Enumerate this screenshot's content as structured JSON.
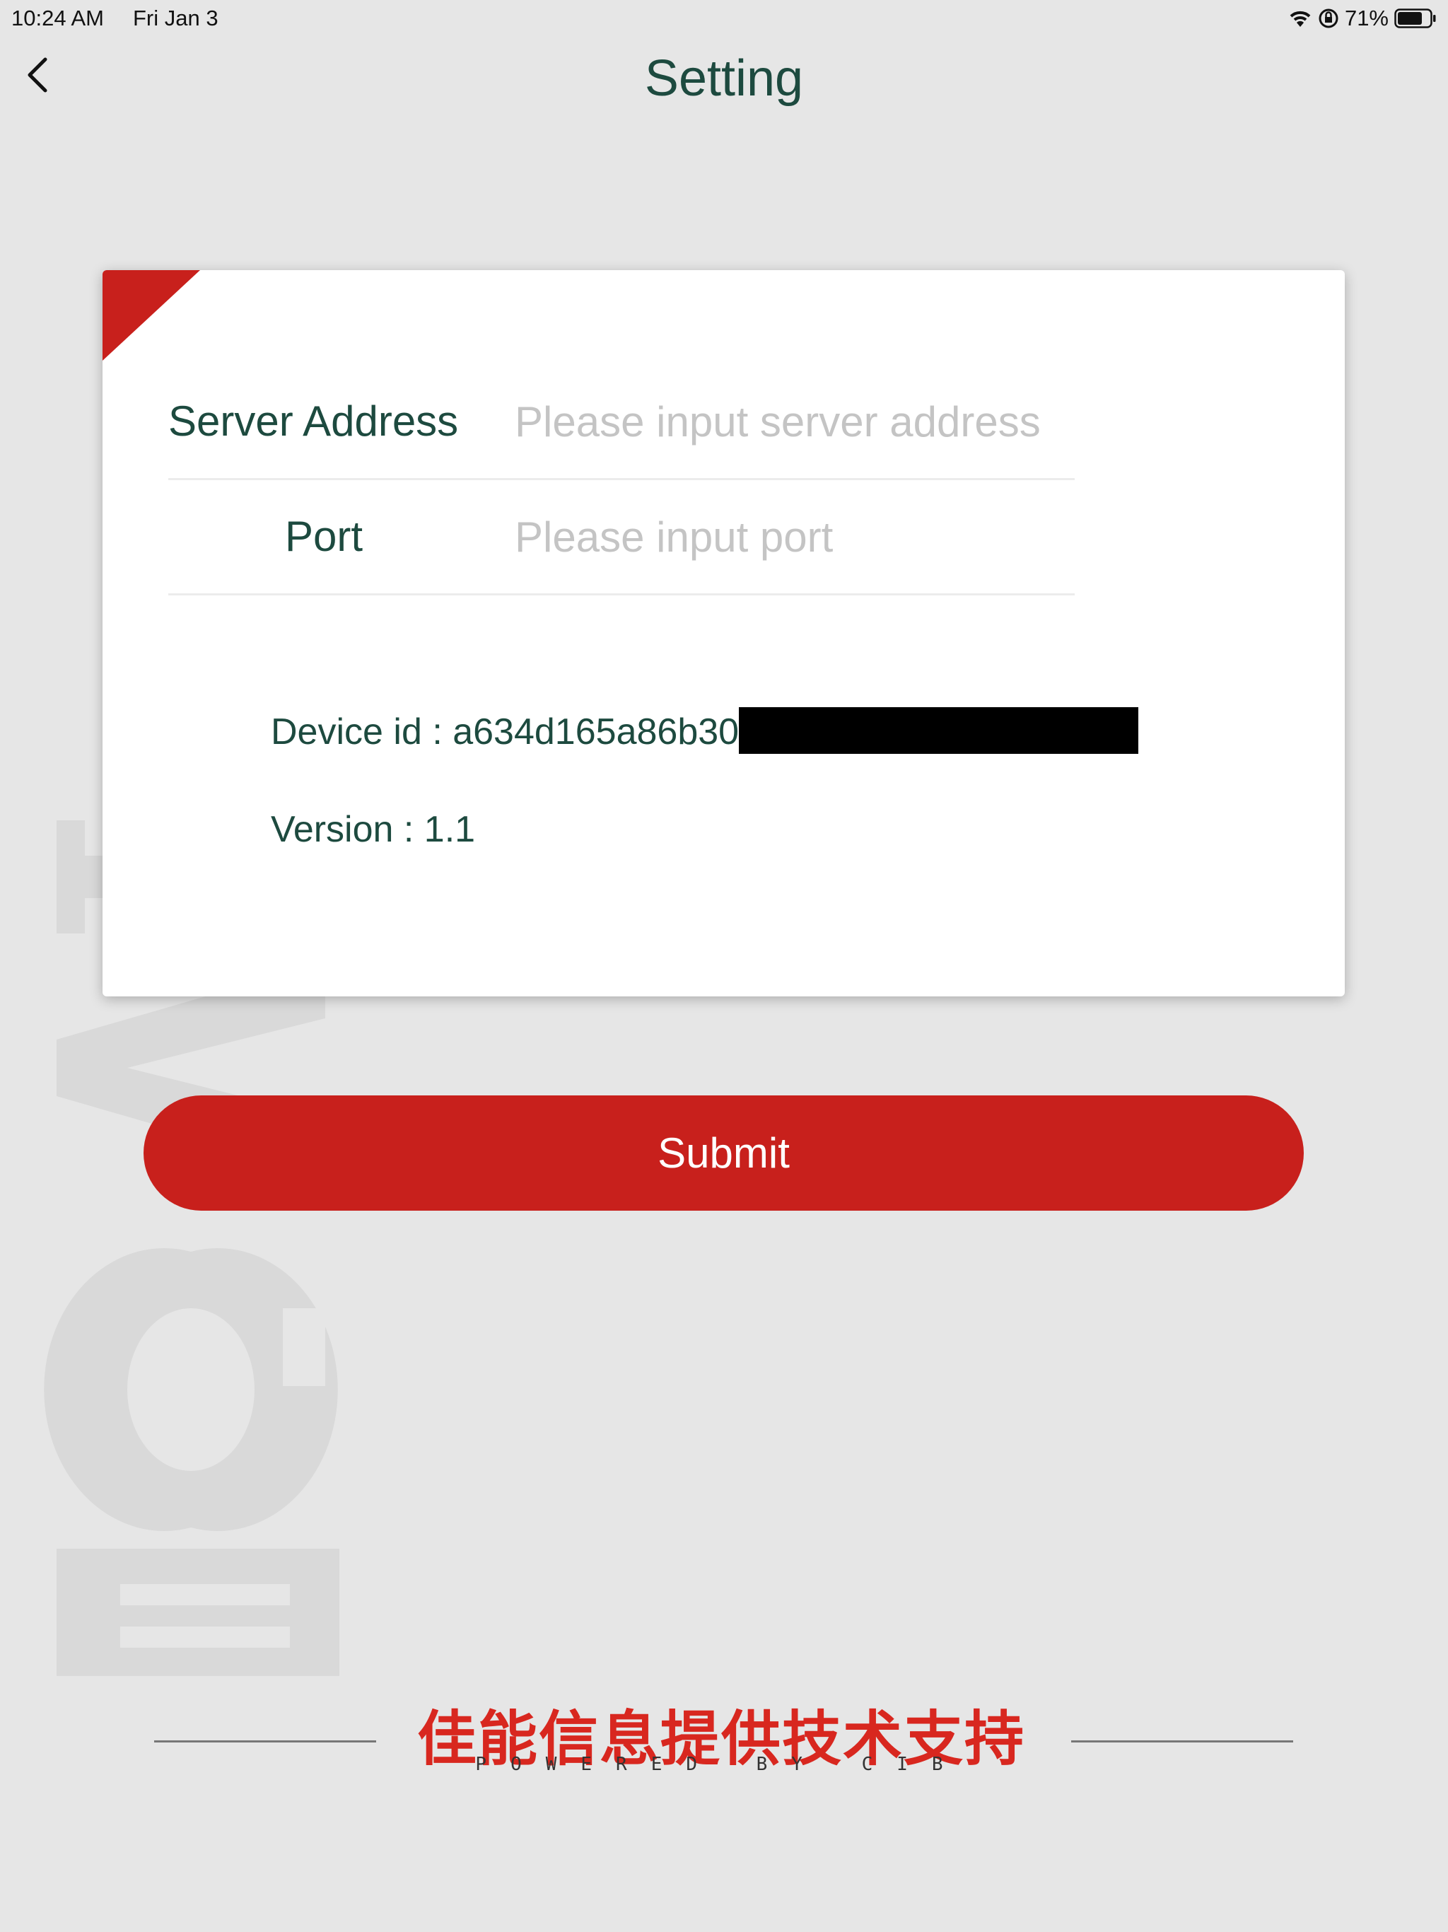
{
  "status_bar": {
    "time": "10:24 AM",
    "date": "Fri Jan 3",
    "battery": "71%",
    "icons": [
      "wifi-icon",
      "orientation-lock-icon",
      "battery-icon"
    ]
  },
  "header": {
    "title": "Setting",
    "back_icon": "chevron-left-icon"
  },
  "form": {
    "server": {
      "label": "Server Address",
      "placeholder": "Please input server address",
      "value": ""
    },
    "port": {
      "label": "Port",
      "placeholder": "Please input port",
      "value": ""
    },
    "device_id": "Device id : a634d165a86b30",
    "version": "Version : 1.1"
  },
  "submit_label": "Submit",
  "footer": {
    "chinese": "佳能信息提供技术支持",
    "english": "POWERED BY CIB"
  },
  "colors": {
    "accent": "#c8201c",
    "title": "#1d4a3f",
    "background": "#e6e6e6"
  }
}
